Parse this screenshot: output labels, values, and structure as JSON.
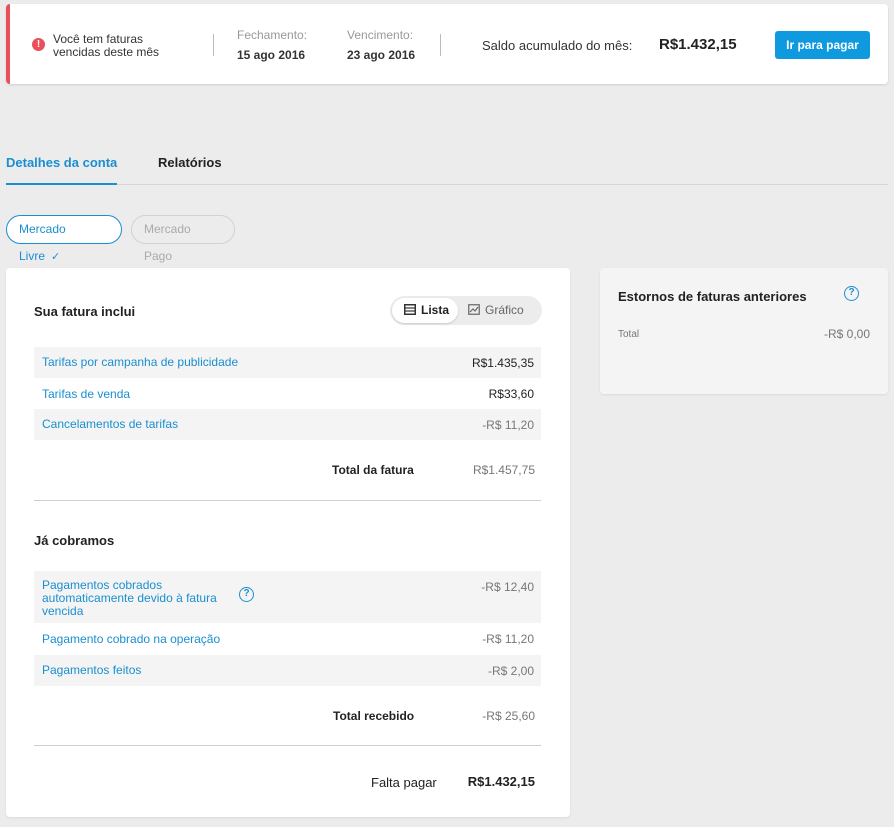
{
  "header": {
    "alert_text": "Você tem faturas vencidas deste mês",
    "closing_label": "Fechamento:",
    "closing_date": "15 ago 2016",
    "due_label": "Vencimento:",
    "due_date": "23 ago 2016",
    "balance_label": "Saldo acumulado do mês:",
    "balance_value": "R$1.432,15",
    "pay_button": "Ir para pagar"
  },
  "tabs": [
    {
      "label": "Detalhes da conta",
      "active": true
    },
    {
      "label": "Relatórios",
      "active": false
    }
  ],
  "filters": [
    {
      "label": "Mercado Livre",
      "selected": true
    },
    {
      "label": "Mercado Pago",
      "selected": false
    }
  ],
  "invoice": {
    "title": "Sua fatura inclui",
    "view_toggle": {
      "list": "Lista",
      "chart": "Gráfico"
    },
    "items": [
      {
        "label": "Tarifas por campanha de publicidade",
        "value": "R$1.435,35"
      },
      {
        "label": "Tarifas de venda",
        "value": "R$33,60"
      },
      {
        "label": "Cancelamentos de tarifas",
        "value": "-R$ 11,20"
      }
    ],
    "total_label": "Total da fatura",
    "total_value": "R$1.457,75"
  },
  "charged": {
    "title": "Já cobramos",
    "items": [
      {
        "label": "Pagamentos cobrados automaticamente devido à fatura vencida",
        "value": "-R$ 12,40"
      },
      {
        "label": "Pagamento cobrado na operação",
        "value": "-R$ 11,20"
      },
      {
        "label": "Pagamentos feitos",
        "value": "-R$ 2,00"
      }
    ],
    "total_label": "Total recebido",
    "total_value": "-R$ 25,60"
  },
  "remaining": {
    "label": "Falta pagar",
    "value": "R$1.432,15"
  },
  "refunds": {
    "title": "Estornos de faturas anteriores",
    "total_label": "Total",
    "total_value": "-R$ 0,00"
  },
  "colors": {
    "accent": "#1a8fd0",
    "button": "#0f9ae0",
    "alert": "#e8505b",
    "background": "#ececec"
  }
}
